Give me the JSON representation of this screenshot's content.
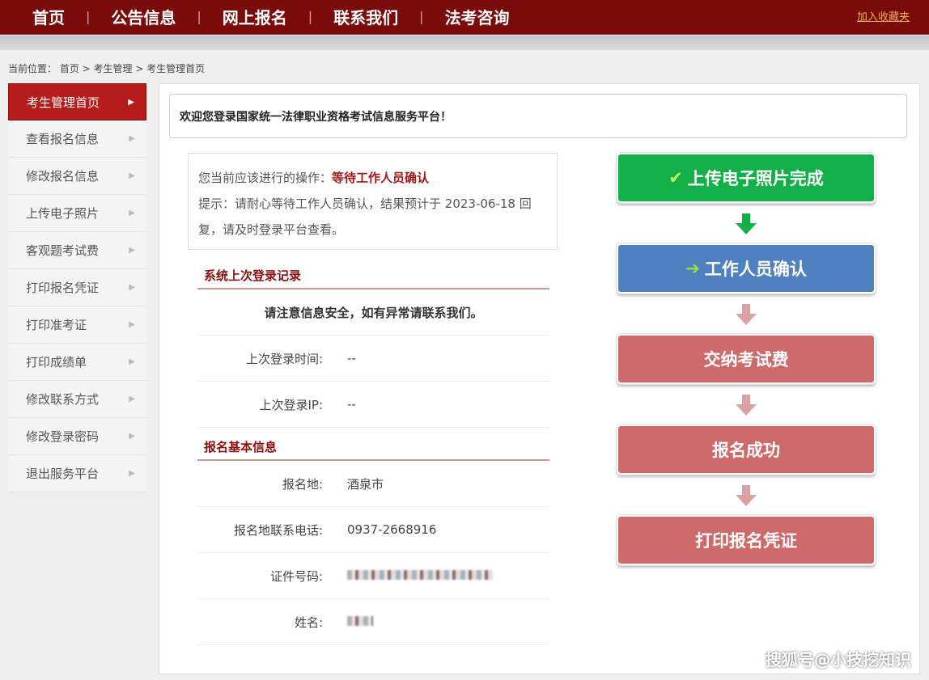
{
  "topnav": {
    "items": [
      "首页",
      "公告信息",
      "网上报名",
      "联系我们",
      "法考咨询"
    ],
    "separator": "|",
    "favorite": "加入收藏夹"
  },
  "breadcrumb": "当前位置： 首页 > 考生管理 > 考生管理首页",
  "sidebar": {
    "items": [
      "考生管理首页",
      "查看报名信息",
      "修改报名信息",
      "上传电子照片",
      "客观题考试费",
      "打印报名凭证",
      "打印准考证",
      "打印成绩单",
      "修改联系方式",
      "修改登录密码",
      "退出服务平台"
    ],
    "arrow": "▶"
  },
  "welcome": "欢迎您登录国家统一法律职业资格考试信息服务平台！",
  "status": {
    "label": "您当前应该进行的操作：",
    "action": "等待工作人员确认",
    "hint": "提示：请耐心等待工作人员确认，结果预计于 2023-06-18 回复，请及时登录平台查看。"
  },
  "login_record": {
    "title": "系统上次登录记录",
    "notice": "请注意信息安全，如有异常请联系我们。",
    "rows": [
      {
        "label": "上次登录时间:",
        "value": "--"
      },
      {
        "label": "上次登录IP:",
        "value": "--"
      }
    ]
  },
  "basic_info": {
    "title": "报名基本信息",
    "rows": [
      {
        "label": "报名地:",
        "value": "酒泉市"
      },
      {
        "label": "报名地联系电话:",
        "value": "0937-2668916"
      },
      {
        "label": "证件号码:"
      },
      {
        "label": "姓名:"
      }
    ]
  },
  "flow": [
    {
      "label": "上传电子照片完成",
      "state": "done",
      "color": "#13b04a"
    },
    {
      "label": "工作人员确认",
      "state": "current",
      "color": "#4f80c0"
    },
    {
      "label": "交纳考试费",
      "state": "pending",
      "color": "#cf6a6a"
    },
    {
      "label": "报名成功",
      "state": "pending",
      "color": "#cf6a6a"
    },
    {
      "label": "打印报名凭证",
      "state": "pending",
      "color": "#cf6a6a"
    }
  ],
  "watermark": "搜狐号@小技挖知识"
}
